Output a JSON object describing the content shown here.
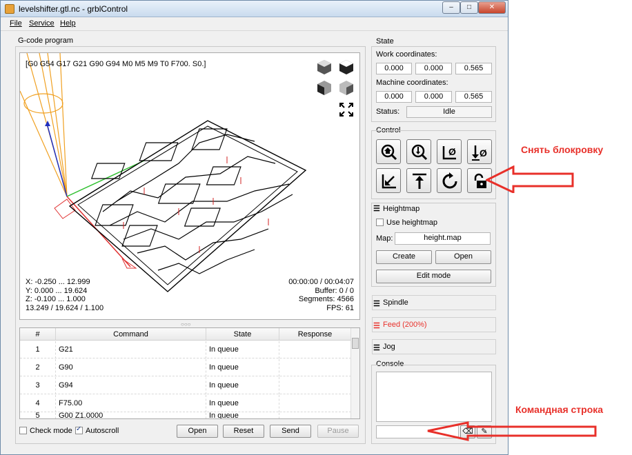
{
  "window": {
    "title": "levelshifter.gtl.nc - grblControl",
    "min": "–",
    "max": "□",
    "close": "✕"
  },
  "menu": [
    "File",
    "Service",
    "Help"
  ],
  "gcode": {
    "group_title": "G-code program",
    "line": "[G0 G54 G17 G21 G90 G94 M0 M5 M9 T0 F700. S0.]",
    "stats_left": [
      "X: -0.250 ... 12.999",
      "Y: 0.000 ... 19.624",
      "Z: -0.100 ... 1.000",
      "13.249 / 19.624 / 1.100"
    ],
    "stats_right": [
      "00:00:00 / 00:04:07",
      "Buffer: 0 / 0",
      "Segments: 4566",
      "FPS: 61"
    ],
    "splitter": "○○○"
  },
  "table": {
    "headers": [
      "#",
      "Command",
      "State",
      "Response"
    ],
    "rows": [
      {
        "n": "1",
        "cmd": "G21",
        "state": "In queue",
        "resp": ""
      },
      {
        "n": "2",
        "cmd": "G90",
        "state": "In queue",
        "resp": ""
      },
      {
        "n": "3",
        "cmd": "G94",
        "state": "In queue",
        "resp": ""
      },
      {
        "n": "4",
        "cmd": "F75.00",
        "state": "In queue",
        "resp": ""
      },
      {
        "n": "5",
        "cmd": "G00 Z1.0000",
        "state": "In queue",
        "resp": ""
      }
    ]
  },
  "bottom": {
    "check_mode": "Check mode",
    "autoscroll": "Autoscroll",
    "open": "Open",
    "reset": "Reset",
    "send": "Send",
    "pause": "Pause"
  },
  "state": {
    "title": "State",
    "work_label": "Work coordinates:",
    "work": [
      "0.000",
      "0.000",
      "0.565"
    ],
    "machine_label": "Machine coordinates:",
    "machine": [
      "0.000",
      "0.000",
      "0.565"
    ],
    "status_label": "Status:",
    "status": "Idle"
  },
  "control": {
    "title": "Control"
  },
  "heightmap": {
    "title": "Heightmap",
    "use_label": "Use heightmap",
    "map_label": "Map:",
    "map_value": "height.map",
    "create": "Create",
    "open": "Open",
    "edit": "Edit mode"
  },
  "sections": {
    "spindle": "Spindle",
    "feed": "Feed (200%)",
    "jog": "Jog",
    "feed_color": "#e8302a"
  },
  "console": {
    "title": "Console"
  },
  "annotations": {
    "unlock": "Снять блокровку",
    "cmdline": "Командная строка",
    "color": "#e8302a"
  }
}
